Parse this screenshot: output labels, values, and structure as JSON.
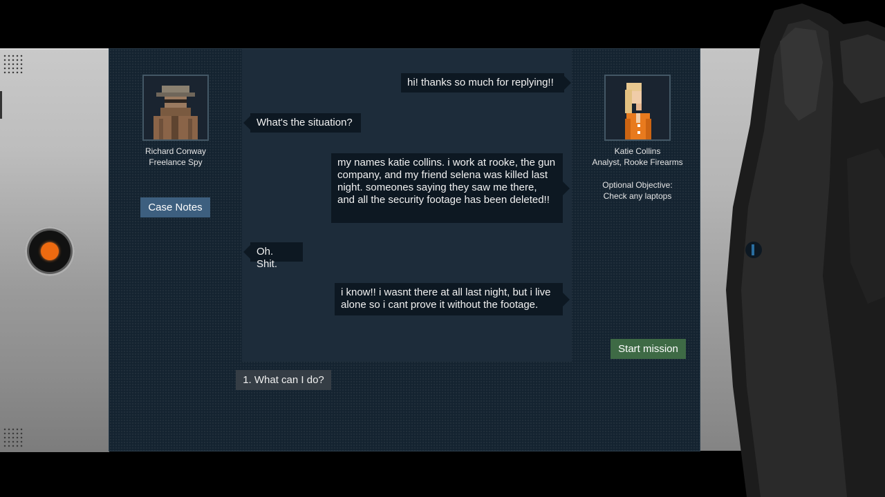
{
  "agent": {
    "name": "Richard Conway",
    "title": "Freelance Spy",
    "portrait_icon": "trenchcoat-spy-portrait"
  },
  "client": {
    "name": "Katie Collins",
    "title": "Analyst, Rooke Firearms",
    "portrait_icon": "blonde-woman-orange-shirt-portrait"
  },
  "objective": {
    "label": "Optional Objective:",
    "text": "Check any laptops"
  },
  "buttons": {
    "case_notes": "Case Notes",
    "start_mission": "Start mission"
  },
  "messages": [
    {
      "from": "client",
      "text": "hi! thanks so much for replying!!"
    },
    {
      "from": "agent",
      "text": "What's the situation?"
    },
    {
      "from": "client",
      "text": "my names katie collins. i work at rooke, the gun company, and my friend selena was killed last night. someones saying they saw me there, and all the security footage has been deleted!!"
    },
    {
      "from": "agent",
      "text": "Oh. Shit."
    },
    {
      "from": "client",
      "text": "i know!! i wasnt there at all last night, but i live alone so i cant prove it without the footage."
    }
  ],
  "choices": [
    {
      "label": "1. What can I do?"
    }
  ],
  "colors": {
    "screen_bg": "#142330",
    "chat_panel_bg": "#1d2c3a",
    "case_notes_button": "#3d5f7f",
    "start_mission_button": "#3e6a45",
    "power_light": "#ee6a10"
  }
}
